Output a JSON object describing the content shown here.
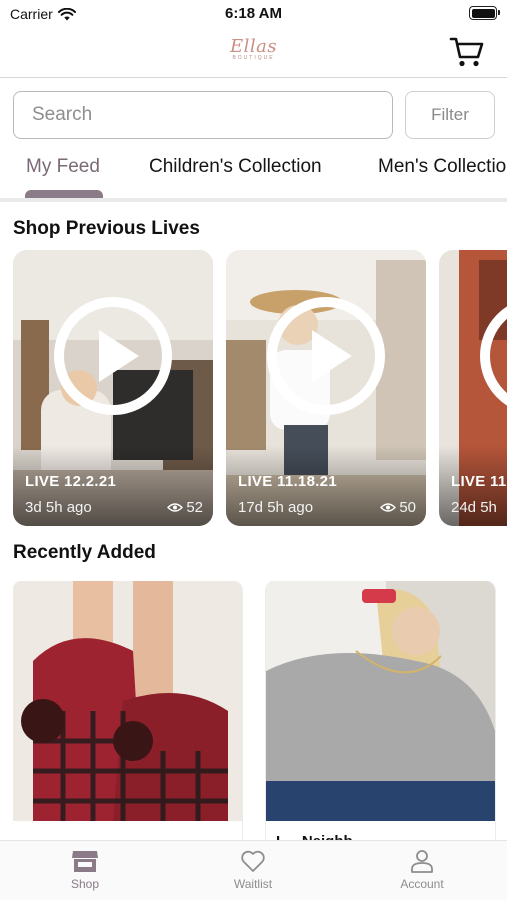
{
  "status_bar": {
    "carrier": "Carrier",
    "time": "6:18 AM"
  },
  "header": {
    "logo_script": "Ellas",
    "logo_sub": "BOUTIQUE"
  },
  "search": {
    "placeholder": "Search",
    "filter_label": "Filter"
  },
  "tabs": [
    {
      "label": "My Feed",
      "active": true
    },
    {
      "label": "Children's Collection",
      "active": false
    },
    {
      "label": "Men's Collection",
      "active": false
    }
  ],
  "sections": {
    "previous_lives": "Shop Previous Lives",
    "recently_added": "Recently Added"
  },
  "lives": [
    {
      "title": "LIVE 12.2.21",
      "ago": "3d 5h ago",
      "views": "52"
    },
    {
      "title": "LIVE 11.18.21",
      "ago": "17d 5h ago",
      "views": "50"
    },
    {
      "title": "LIVE 11",
      "ago": "24d 5h",
      "views": ""
    }
  ],
  "products": [
    {
      "name": ""
    },
    {
      "name": "L... Neighb..."
    }
  ],
  "bottom_nav": [
    {
      "label": "Shop",
      "icon": "shop-icon",
      "active": true
    },
    {
      "label": "Waitlist",
      "icon": "heart-icon",
      "active": false
    },
    {
      "label": "Account",
      "icon": "user-icon",
      "active": false
    }
  ],
  "colors": {
    "accent": "#8b7a88",
    "logo": "#c98f86"
  }
}
